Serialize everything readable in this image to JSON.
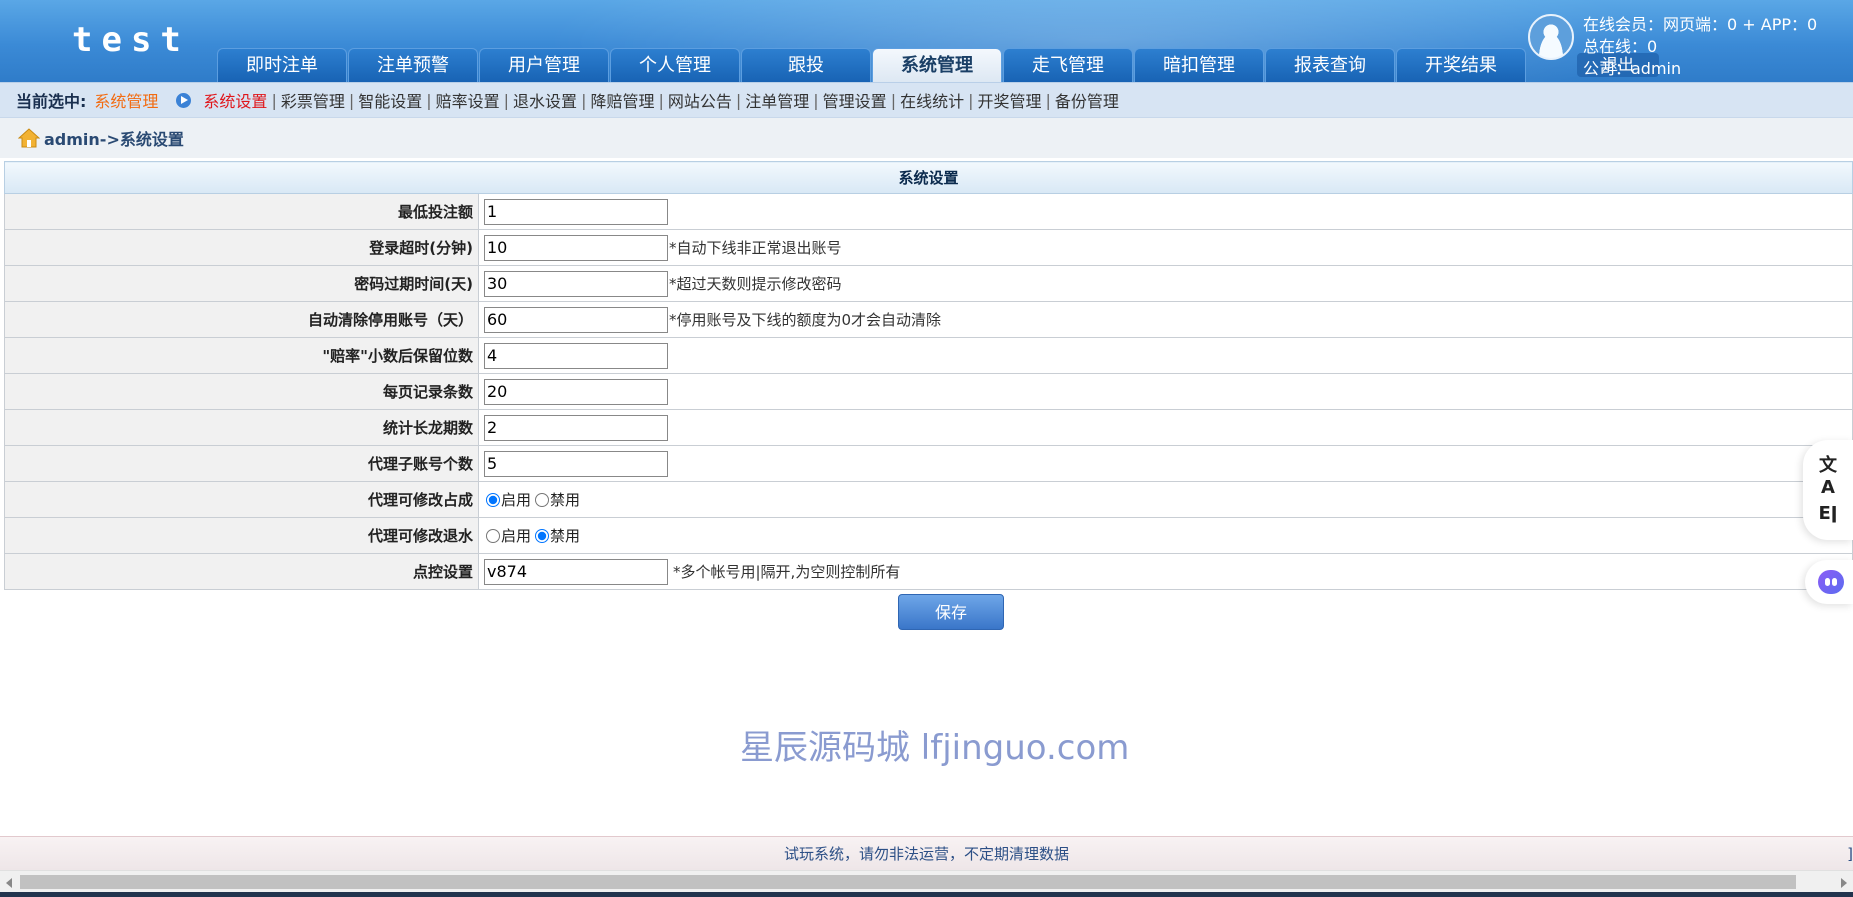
{
  "header": {
    "logo": "test",
    "nav_tabs": [
      {
        "label": "即时注单",
        "active": false
      },
      {
        "label": "注单预警",
        "active": false
      },
      {
        "label": "用户管理",
        "active": false
      },
      {
        "label": "个人管理",
        "active": false
      },
      {
        "label": "跟投",
        "active": false
      },
      {
        "label": "系统管理",
        "active": true
      },
      {
        "label": "走飞管理",
        "active": false
      },
      {
        "label": "暗扣管理",
        "active": false
      },
      {
        "label": "报表查询",
        "active": false
      },
      {
        "label": "开奖结果",
        "active": false
      }
    ],
    "user_info": {
      "online_members": "在线会员：网页端：0 + APP：0",
      "total_online": "总在线：0",
      "company": "公司：admin"
    },
    "logout_label": "退出"
  },
  "subnav": {
    "current_label": "当前选中:",
    "current_value": "系统管理",
    "items": [
      {
        "label": "系统设置",
        "active": true
      },
      {
        "label": "彩票管理",
        "active": false
      },
      {
        "label": "智能设置",
        "active": false
      },
      {
        "label": "赔率设置",
        "active": false
      },
      {
        "label": "退水设置",
        "active": false
      },
      {
        "label": "降赔管理",
        "active": false
      },
      {
        "label": "网站公告",
        "active": false
      },
      {
        "label": "注单管理",
        "active": false
      },
      {
        "label": "管理设置",
        "active": false
      },
      {
        "label": "在线统计",
        "active": false
      },
      {
        "label": "开奖管理",
        "active": false
      },
      {
        "label": "备份管理",
        "active": false
      }
    ]
  },
  "breadcrumb": {
    "text": "admin->系统设置"
  },
  "settings": {
    "title": "系统设置",
    "min_bet": {
      "label": "最低投注额",
      "value": "1"
    },
    "login_timeout": {
      "label": "登录超时(分钟)",
      "value": "10",
      "hint": "*自动下线非正常退出账号"
    },
    "password_expiry": {
      "label": "密码过期时间(天)",
      "value": "30",
      "hint": "*超过天数则提示修改密码"
    },
    "auto_clear": {
      "label": "自动清除停用账号（天）",
      "value": "60",
      "hint": "*停用账号及下线的额度为0才会自动清除"
    },
    "odds_decimals": {
      "label": "\"赔率\"小数后保留位数",
      "value": "4"
    },
    "page_size": {
      "label": "每页记录条数",
      "value": "20"
    },
    "long_dragon": {
      "label": "统计长龙期数",
      "value": "2"
    },
    "sub_accounts": {
      "label": "代理子账号个数",
      "value": "5"
    },
    "agent_share": {
      "label": "代理可修改占成",
      "enable": "启用",
      "disable": "禁用",
      "selected": "enable"
    },
    "agent_rebate": {
      "label": "代理可修改退水",
      "enable": "启用",
      "disable": "禁用",
      "selected": "disable"
    },
    "point_control": {
      "label": "点控设置",
      "value": "v874",
      "hint": "*多个帐号用|隔开,为空则控制所有"
    },
    "save_label": "保存"
  },
  "watermark": "星辰源码城  lfjinguo.com",
  "footer": {
    "notice": "试玩系统，请勿非法运营，不定期清理数据",
    "right_mark": "]"
  },
  "float_toolbar": {
    "icons": [
      "translate-icon",
      "reader-icon",
      "assistant-icon"
    ],
    "translate_glyph": "文A",
    "reader_glyph": "Eǀ"
  },
  "colors": {
    "header_blue": "#3b8ad6",
    "subnav_active": "#e0161b",
    "current_value": "#f26b11",
    "save_button": "#3a76c9"
  }
}
